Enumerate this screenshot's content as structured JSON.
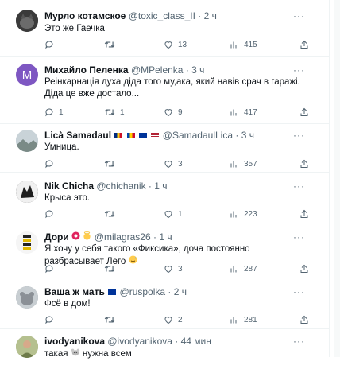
{
  "tweets": [
    {
      "name": "Мурло котамское",
      "handle": "@toxic_class_II",
      "dot": "·",
      "time": "2 ч",
      "text": [
        "Это же Гаечка"
      ],
      "replies": "",
      "retweets": "",
      "likes": "13",
      "views": "415",
      "more": "···",
      "avatar_color": "#4a4a4a"
    },
    {
      "name": "Михайло Пеленка",
      "handle": "@MPelenka",
      "dot": "·",
      "time": "3 ч",
      "text": [
        "Реінкарнація духа діда того му,ака, який навів срач в гаражі.",
        "Діда це вже достало..."
      ],
      "replies": "1",
      "retweets": "1",
      "likes": "9",
      "views": "417",
      "more": "···",
      "avatar_letter": "M",
      "avatar_color": "#7e57c2"
    },
    {
      "name": "Licà Samadaul",
      "handle": "@SamadaulLica",
      "dot": "·",
      "time": "3 ч",
      "text": [
        "Умница."
      ],
      "replies": "",
      "retweets": "",
      "likes": "3",
      "views": "357",
      "more": "···",
      "avatar_color": "#b7c2c9"
    },
    {
      "name": "Nik Chicha",
      "handle": "@chichanik",
      "dot": "·",
      "time": "1 ч",
      "text": [
        "Крыса это."
      ],
      "replies": "",
      "retweets": "",
      "likes": "1",
      "views": "223",
      "more": "···",
      "avatar_color": "#222222"
    },
    {
      "name": "Дори",
      "handle": "@milagras26",
      "dot": "·",
      "time": "1 ч",
      "text": [
        "Я хочу у себя такого «Фиксика», доча постоянно разбрасывает Лего"
      ],
      "replies": "",
      "retweets": "",
      "likes": "3",
      "views": "287",
      "more": "···",
      "avatar_color": "#f3f3f3"
    },
    {
      "name": "Ваша ж мать",
      "handle": "@ruspolka",
      "dot": "·",
      "time": "2 ч",
      "text": [
        "Фсё в дом!"
      ],
      "replies": "",
      "retweets": "",
      "likes": "2",
      "views": "281",
      "more": "···",
      "avatar_color": "#8a9299"
    },
    {
      "name": "ivodyanikova",
      "handle": "@ivodyanikova",
      "dot": "·",
      "time": "44 мин",
      "text_before": "такая",
      "text_after": "нужна всем",
      "more": "···",
      "avatar_color": "#9aa67a"
    }
  ]
}
